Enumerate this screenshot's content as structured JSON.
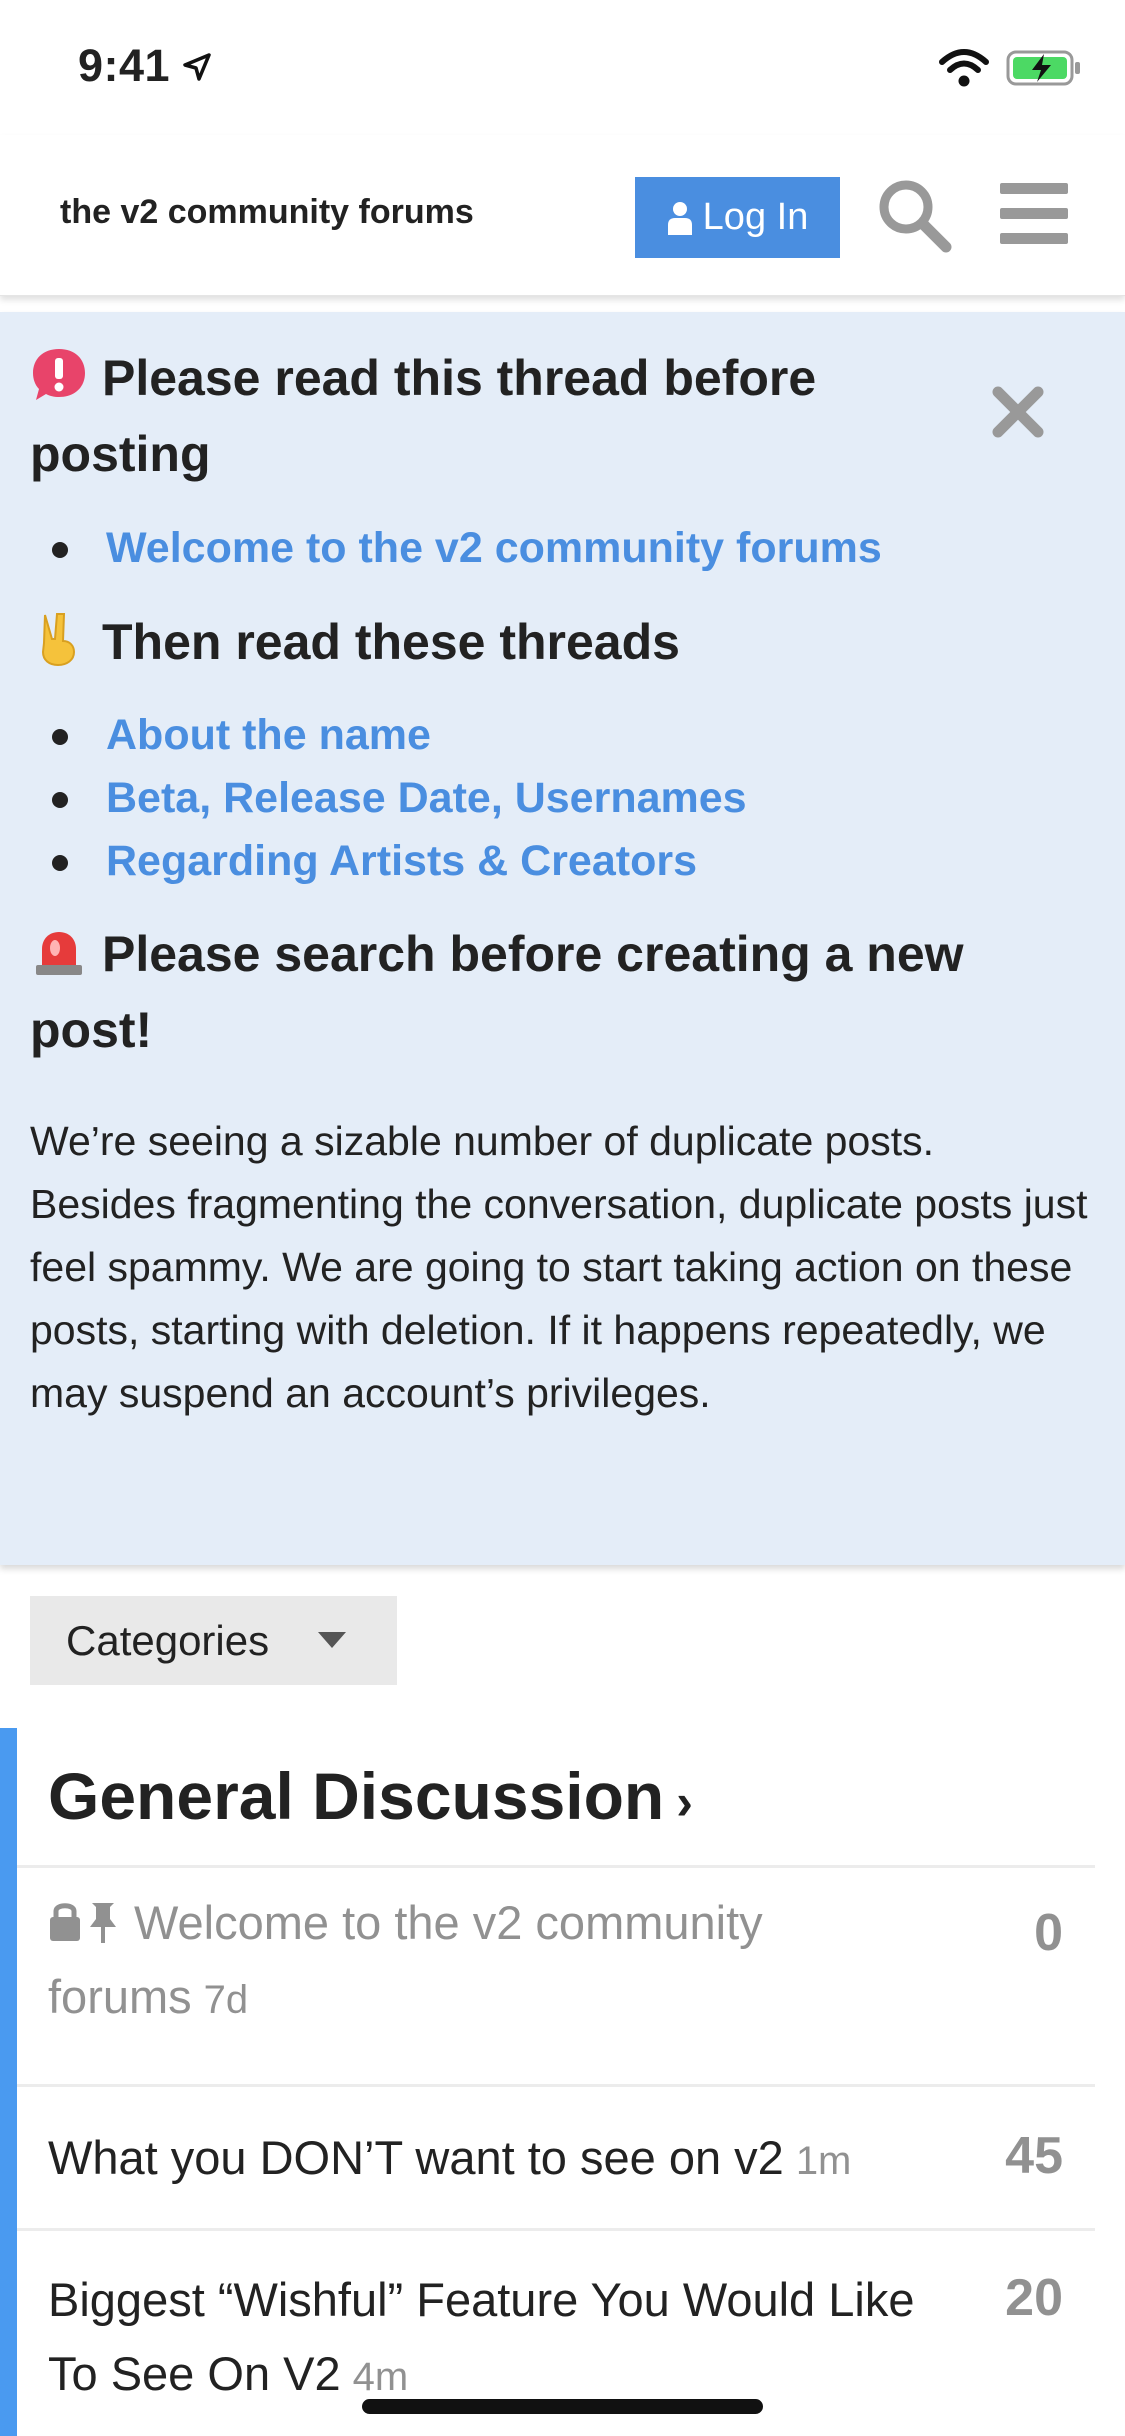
{
  "status_bar": {
    "time": "9:41"
  },
  "header": {
    "site_title": "the v2 community forums",
    "login_label": "Log In"
  },
  "banner": {
    "heading1": "Please read this thread before posting",
    "list1": [
      "Welcome to the v2 community forums"
    ],
    "heading2": "Then read these threads",
    "list2": [
      "About the name",
      "Beta, Release Date, Usernames",
      "Regarding Artists & Creators"
    ],
    "heading3": "Please search before creating a new post!",
    "paragraph": "We’re seeing a sizable number of duplicate posts. Besides fragmenting the conversation, duplicate posts just feel spammy. We are going to start taking action on these posts, starting with deletion. If it happens repeatedly, we may suspend an account’s privileges."
  },
  "categories_dropdown": {
    "label": "Categories"
  },
  "category": {
    "title": "General Discussion",
    "chevron": "›",
    "topics": [
      {
        "title": "Welcome to the v2 community forums",
        "age": "7d",
        "count": "0",
        "pinned": true,
        "locked": true
      },
      {
        "title": "What you DON’T want to see on v2",
        "age": "1m",
        "count": "45"
      },
      {
        "title": "Biggest “Wishful” Feature You Would Like To See On V2",
        "age": "4m",
        "count": "20"
      }
    ]
  },
  "colors": {
    "accent": "#4a8ee0",
    "category_bar": "#4a9af0",
    "banner_bg": "#e4edf8"
  }
}
